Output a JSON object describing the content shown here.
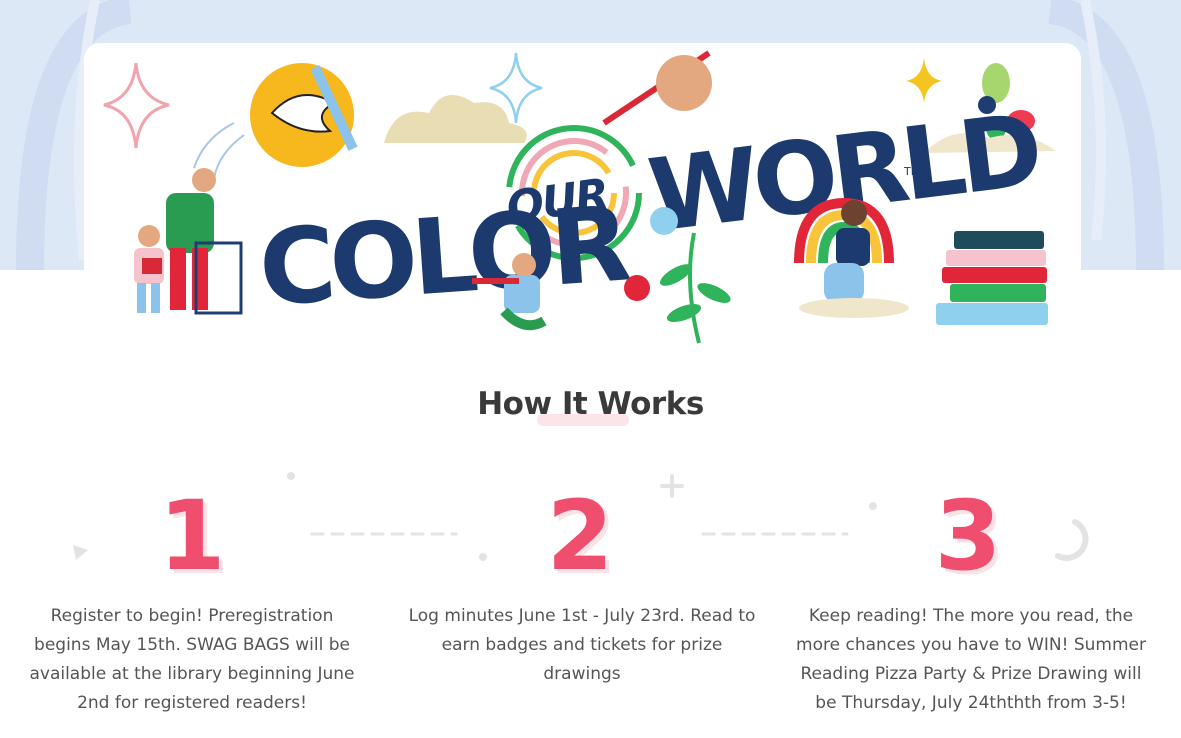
{
  "banner": {
    "title_word_1": "COLOR",
    "title_word_2": "OUR",
    "title_word_3": "WORLD",
    "trademark": "TM"
  },
  "how_it_works": {
    "title": "How It Works",
    "steps": [
      {
        "number": "1",
        "text": "Register to begin! Preregistration begins May 15th. SWAG BAGS will be available at the library beginning June 2nd for registered readers!"
      },
      {
        "number": "2",
        "text": "Log minutes June 1st - July 23rd. Read to earn badges and tickets for prize drawings"
      },
      {
        "number": "3",
        "text": "Keep reading! The more you read, the more chances you have to WIN! Summer Reading Pizza Party & Prize Drawing will be Thursday, July 24ththth from 3-5!"
      }
    ]
  },
  "colors": {
    "accent": "#f04e6e",
    "title_navy": "#1c3a6e",
    "background_blue": "#dde8f7",
    "text_gray": "#555555"
  }
}
